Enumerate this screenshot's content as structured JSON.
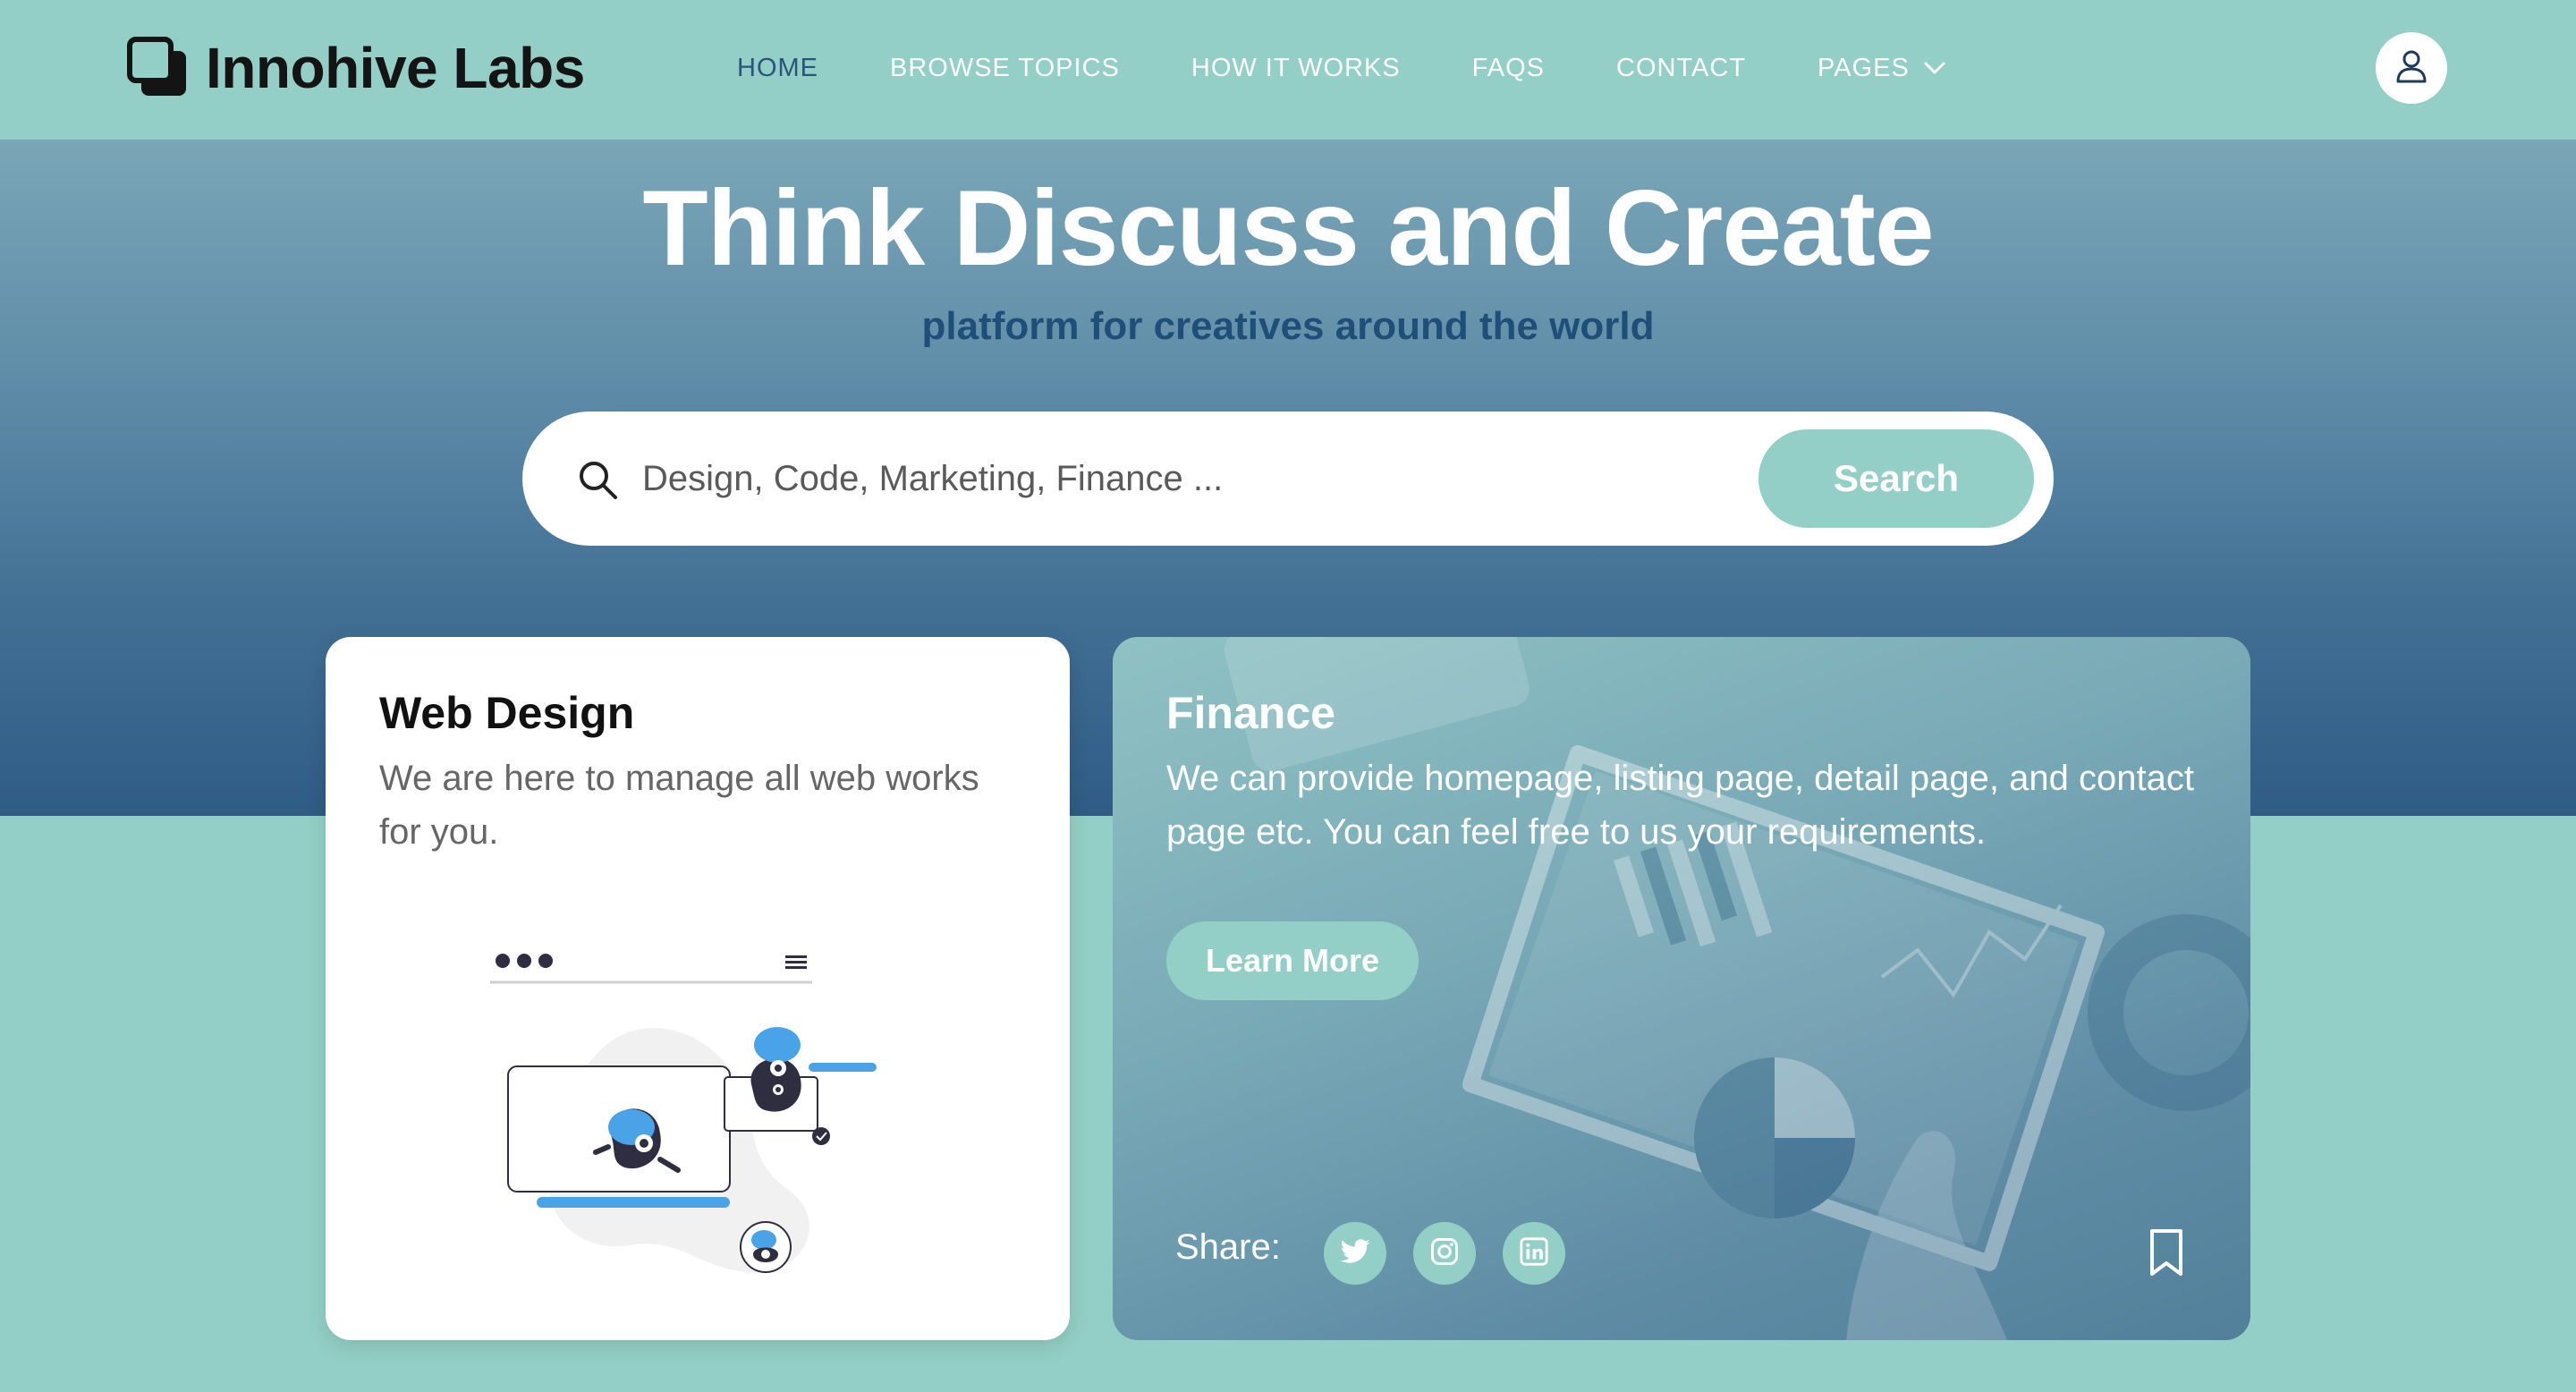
{
  "brand": {
    "name": "Innohive Labs",
    "icon": "stacked-squares-logo"
  },
  "nav": {
    "items": [
      {
        "label": "HOME",
        "active": true
      },
      {
        "label": "BROWSE TOPICS"
      },
      {
        "label": "HOW IT WORKS"
      },
      {
        "label": "FAQS"
      },
      {
        "label": "CONTACT"
      },
      {
        "label": "PAGES",
        "dropdown": true
      }
    ],
    "user_icon": "user-icon"
  },
  "hero": {
    "title": "Think Discuss and Create",
    "subtitle": "platform for creatives around the world"
  },
  "search": {
    "placeholder": "Design, Code, Marketing, Finance ...",
    "button_label": "Search",
    "icon": "search-icon"
  },
  "cards": {
    "web_design": {
      "title": "Web Design",
      "description": "We are here to manage all web works for you."
    },
    "finance": {
      "title": "Finance",
      "description": "We can provide homepage, listing page, detail page, and contact page etc. You can feel free to us your requirements.",
      "button_label": "Learn More",
      "share_label": "Share:",
      "socials": [
        "twitter-icon",
        "instagram-icon",
        "linkedin-icon"
      ],
      "bookmark_icon": "bookmark-icon"
    }
  },
  "colors": {
    "accent": "#93cfc6",
    "hero_dark": "#2f5c85",
    "nav_active": "#2b5479",
    "subtitle": "#1f4f79",
    "illustration_blue": "#4aa3e6",
    "illustration_dark": "#2f2e41"
  }
}
